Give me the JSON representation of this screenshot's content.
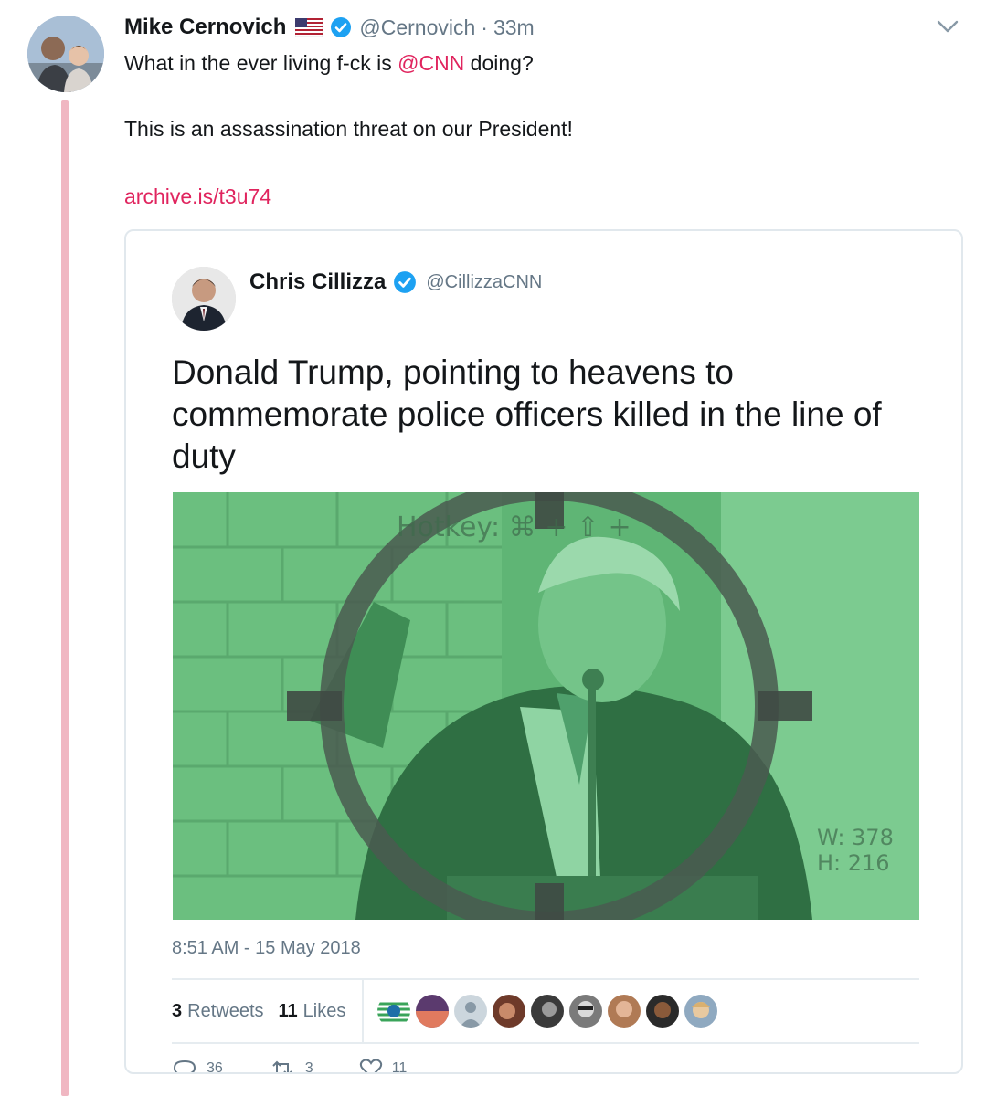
{
  "tweet": {
    "author_name": "Mike Cernovich",
    "author_handle": "@Cernovich",
    "separator": "·",
    "time_ago": "33m",
    "text_line1_prefix": "What in the ever living f-ck is ",
    "text_line1_mention": "@CNN",
    "text_line1_suffix": " doing?",
    "text_line2": "This is an assassination threat on our President!",
    "link": "archive.is/t3u74"
  },
  "quoted": {
    "author_name": "Chris Cillizza",
    "author_handle": "@CillizzaCNN",
    "text": "Donald Trump, pointing to heavens to commemorate police officers killed in the line of duty",
    "image_overlay_hotkey": "Hotkey: ⌘ + ⇧ +",
    "image_overlay_w": "W: 378",
    "image_overlay_h": "H: 216",
    "timestamp": "8:51 AM - 15 May 2018",
    "retweets_count": "3",
    "retweets_label": "Retweets",
    "likes_count": "11",
    "likes_label": "Likes",
    "reply_count": "36",
    "retweet_action_count": "3",
    "like_action_count": "11"
  },
  "colors": {
    "accent": "#e0245e",
    "thread_line": "#f0b7c2",
    "verified": "#1da1f2",
    "muted": "#657786"
  }
}
